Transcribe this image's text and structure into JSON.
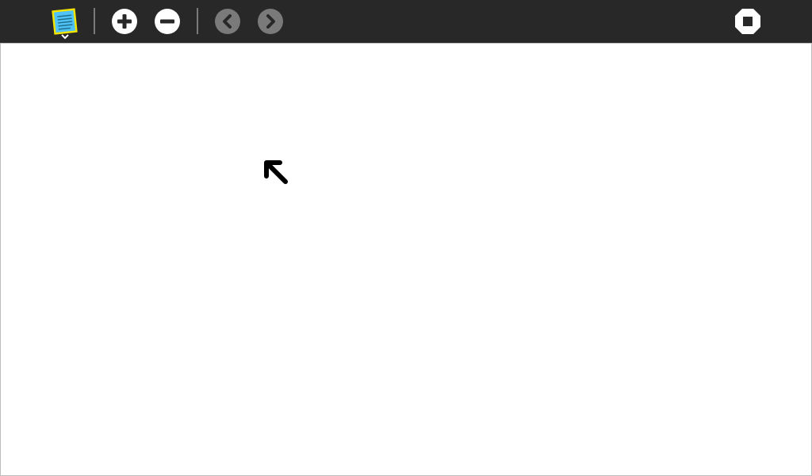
{
  "toolbar": {
    "items": [
      {
        "name": "notes-menu",
        "icon": "note-icon",
        "has_dropdown": true
      },
      {
        "name": "zoom-in",
        "icon": "plus-circle-icon"
      },
      {
        "name": "zoom-out",
        "icon": "minus-circle-icon"
      },
      {
        "name": "previous",
        "icon": "chevron-left-icon",
        "enabled": false
      },
      {
        "name": "next",
        "icon": "chevron-right-icon",
        "enabled": false
      },
      {
        "name": "stop",
        "icon": "stop-icon"
      }
    ]
  },
  "colors": {
    "toolbar_background": "#282828",
    "icon_foreground": "#ffffff",
    "disabled_icon": "#7a7a7a",
    "note_fill": "#4fc3f7",
    "note_border": "#f2e200",
    "canvas_background": "#ffffff",
    "pointer": "#000000"
  },
  "canvas": {
    "pointer_icon": "arrow-up-left-icon"
  }
}
